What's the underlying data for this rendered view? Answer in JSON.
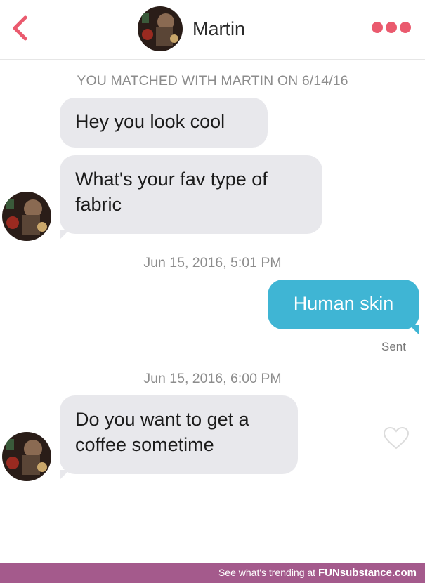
{
  "header": {
    "contact_name": "Martin",
    "back_icon": "chevron-left-icon",
    "more_icon": "more-options-icon",
    "accent_color": "#ea5a6e"
  },
  "match_banner": "YOU MATCHED WITH MARTIN ON 6/14/16",
  "messages": [
    {
      "direction": "incoming",
      "text": "Hey you look cool"
    },
    {
      "direction": "incoming",
      "text_line1": "What's your fav type of",
      "text_line2": "fabric"
    },
    {
      "direction": "outgoing",
      "text": "Human skin",
      "status": "Sent"
    },
    {
      "direction": "incoming",
      "text_line1": "Do you want to get a",
      "text_line2": "coffee sometime"
    }
  ],
  "timestamps": [
    "Jun 15, 2016, 5:01 PM",
    "Jun 15, 2016, 6:00 PM"
  ],
  "heart_icon": "heart-icon",
  "footer": {
    "prefix": "See what's trending at ",
    "brand_bold": "FUN",
    "brand_rest": "substance.com",
    "background_color": "#a45a8c"
  },
  "colors": {
    "incoming_bubble": "#e8e8ec",
    "outgoing_bubble": "#3fb5d4"
  }
}
